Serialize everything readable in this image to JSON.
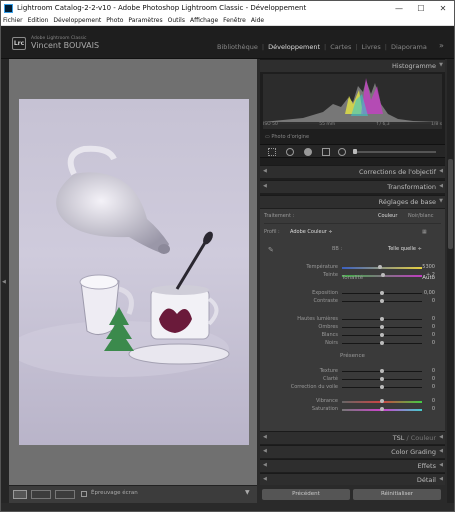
{
  "window": {
    "title": "Lightroom Catalog-2-2-v10 - Adobe Photoshop Lightroom Classic - Développement",
    "min": "—",
    "max": "☐",
    "close": "✕"
  },
  "menu": [
    "Fichier",
    "Edition",
    "Développement",
    "Photo",
    "Paramètres",
    "Outils",
    "Affichage",
    "Fenêtre",
    "Aide"
  ],
  "identity": {
    "logo": "Lrc",
    "app": "Adobe Lightroom Classic",
    "user": "Vincent BOUVAIS"
  },
  "modules": [
    "Bibliothèque",
    "Développement",
    "Cartes",
    "Livres",
    "Diaporama"
  ],
  "active_module": "Développement",
  "histogram": {
    "title": "Histogramme",
    "iso": "ISO 50",
    "focal": "55 mm",
    "aperture": "f / 6,3",
    "shutter": "1/8 s",
    "original": "Photo d'origine"
  },
  "panels": {
    "lens": "Corrections de l'objectif",
    "transform": "Transformation",
    "basic": "Réglages de base",
    "tsl": "TSL",
    "tsl2": "/ Couleur",
    "grading": "Color Grading",
    "effects": "Effets",
    "detail": "Détail"
  },
  "basic": {
    "treatment": "Traitement :",
    "color": "Couleur",
    "bw": "Noir/blanc",
    "profile": "Profil :",
    "profile_value": "Adobe Couleur ÷",
    "wb_label": "BB :",
    "wb_value": "Telle quelle ÷",
    "tonality": "Tonalité",
    "auto": "Auto",
    "presence": "Présence",
    "sliders": [
      {
        "label": "Température",
        "value": "5300",
        "pos": 0.48
      },
      {
        "label": "Teinte",
        "value": "+ 2",
        "pos": 0.51
      },
      {
        "label": "Exposition",
        "value": "0,00",
        "pos": 0.5
      },
      {
        "label": "Contraste",
        "value": "0",
        "pos": 0.5
      },
      {
        "label": "Hautes lumières",
        "value": "0",
        "pos": 0.5
      },
      {
        "label": "Ombres",
        "value": "0",
        "pos": 0.5
      },
      {
        "label": "Blancs",
        "value": "0",
        "pos": 0.5
      },
      {
        "label": "Noirs",
        "value": "0",
        "pos": 0.5
      },
      {
        "label": "Texture",
        "value": "0",
        "pos": 0.5
      },
      {
        "label": "Clarté",
        "value": "0",
        "pos": 0.5
      },
      {
        "label": "Correction du voile",
        "value": "0",
        "pos": 0.5
      },
      {
        "label": "Vibrance",
        "value": "0",
        "pos": 0.5
      },
      {
        "label": "Saturation",
        "value": "0",
        "pos": 0.5
      }
    ]
  },
  "buttons": {
    "previous": "Précédent",
    "reset": "Réinitialiser"
  },
  "filmstrip": {
    "proof": "Épreuvage écran"
  },
  "colors": {
    "accent": "#d6d6d6",
    "panel": "#3a3a3a",
    "bg": "#707070"
  }
}
